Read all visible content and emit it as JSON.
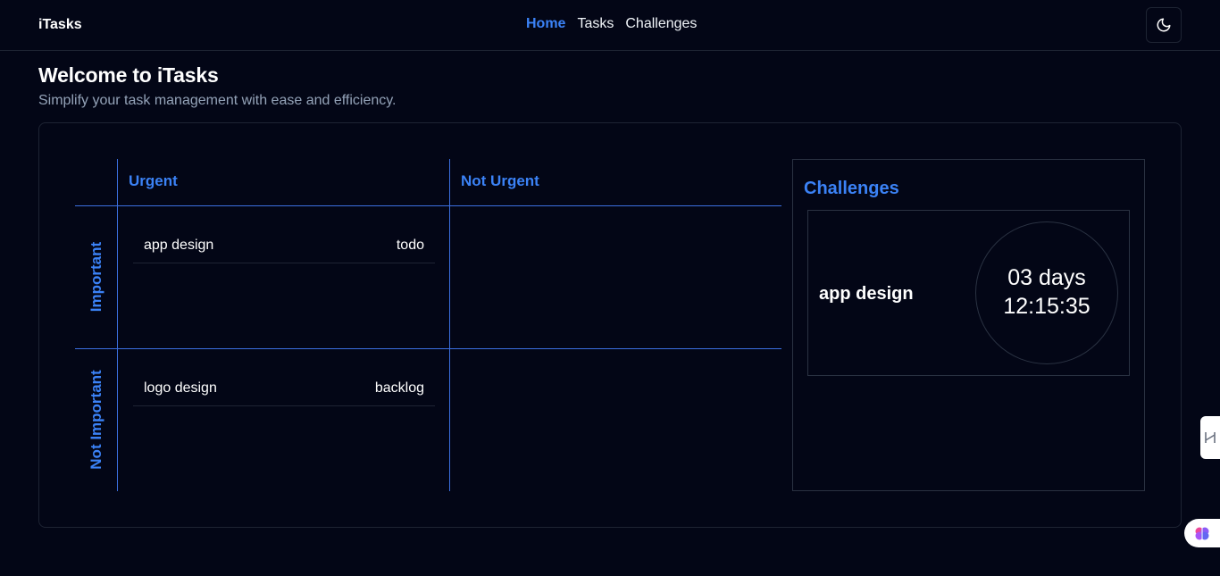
{
  "header": {
    "brand": "iTasks",
    "nav": [
      {
        "label": "Home",
        "active": true
      },
      {
        "label": "Tasks",
        "active": false
      },
      {
        "label": "Challenges",
        "active": false
      }
    ],
    "theme_toggle_icon": "moon-icon"
  },
  "page": {
    "title": "Welcome to iTasks",
    "subtitle": "Simplify your task management with ease and efficiency."
  },
  "matrix": {
    "columns": [
      "Urgent",
      "Not Urgent"
    ],
    "rows": [
      "Important",
      "Not Important"
    ],
    "quadrants": {
      "important_urgent": [
        {
          "name": "app design",
          "status": "todo"
        }
      ],
      "not_important_urgent": [
        {
          "name": "logo design",
          "status": "backlog"
        }
      ]
    }
  },
  "challenges": {
    "title": "Challenges",
    "items": [
      {
        "name": "app design",
        "days": "03 days",
        "time": "12:15:35"
      }
    ]
  },
  "colors": {
    "background": "#030616",
    "accent": "#3b82f6",
    "border": "#1e2433",
    "matrix_line": "#3b6fe0",
    "subtitle": "#94a3b8"
  }
}
